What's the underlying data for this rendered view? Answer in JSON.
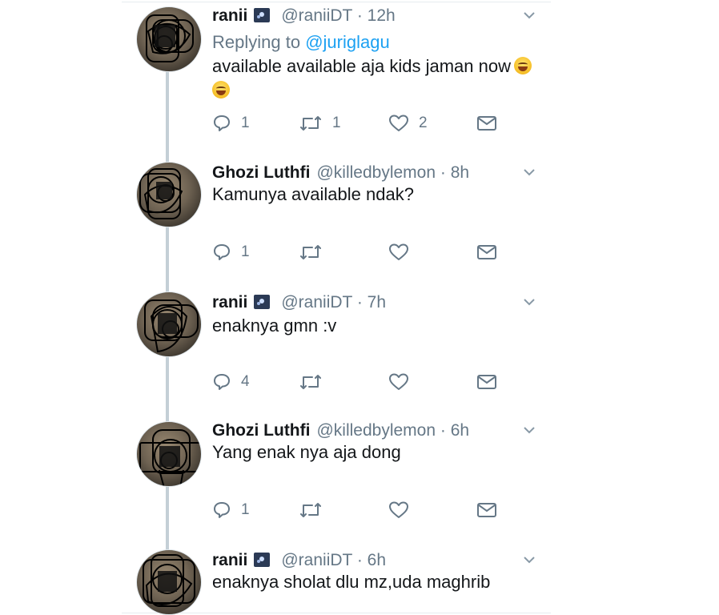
{
  "tweets": [
    {
      "name": "ranii",
      "handle": "@raniiDT",
      "dot": "·",
      "time": "12h",
      "replying_prefix": "Replying to",
      "replying_to": "@juriglagu",
      "text": "available available aja kids jaman now",
      "counts": {
        "reply": "1",
        "retweet": "1",
        "like": "2"
      }
    },
    {
      "name": "Ghozi Luthfi",
      "handle": "@killedbylemon",
      "dot": "·",
      "time": "8h",
      "text": "Kamunya available ndak?",
      "counts": {
        "reply": "1",
        "retweet": "",
        "like": ""
      }
    },
    {
      "name": "ranii",
      "handle": "@raniiDT",
      "dot": "·",
      "time": "7h",
      "text": "enaknya gmn :v",
      "counts": {
        "reply": "4",
        "retweet": "",
        "like": ""
      }
    },
    {
      "name": "Ghozi Luthfi",
      "handle": "@killedbylemon",
      "dot": "·",
      "time": "6h",
      "text": "Yang enak nya aja dong",
      "counts": {
        "reply": "1",
        "retweet": "",
        "like": ""
      }
    },
    {
      "name": "ranii",
      "handle": "@raniiDT",
      "dot": "·",
      "time": "6h",
      "text": "enaknya sholat dlu mz,uda maghrib"
    }
  ],
  "icons": {
    "reply": "reply-icon",
    "retweet": "retweet-icon",
    "like": "heart-icon",
    "dm": "mail-icon",
    "more": "chevron-down-icon",
    "emoji": "grinning-sweat-emoji"
  },
  "colors": {
    "link": "#1da1f2",
    "muted": "#657786",
    "text": "#14171a"
  }
}
